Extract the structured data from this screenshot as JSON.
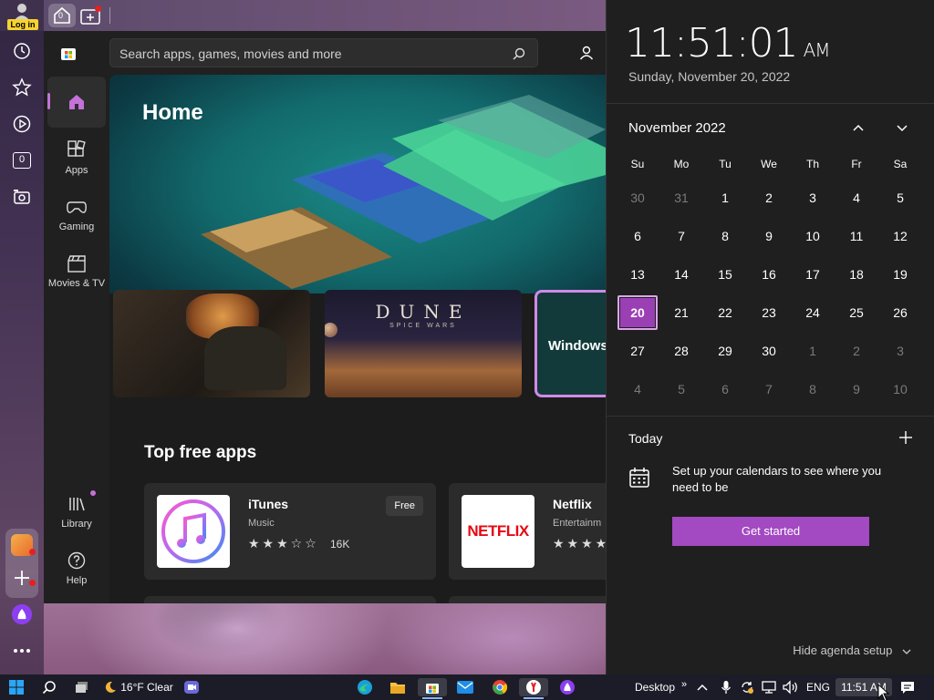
{
  "browser": {
    "login_label": "Log in",
    "tab_counter": "0",
    "side_counter": "0"
  },
  "store": {
    "search_placeholder": "Search apps, games, movies and more",
    "nav": {
      "apps": "Apps",
      "gaming": "Gaming",
      "movies": "Movies & TV",
      "library": "Library",
      "help": "Help"
    },
    "hero_title": "Home",
    "promo_cards": [
      {
        "title": ""
      },
      {
        "title": "DUNE",
        "subtitle": "SPICE WARS"
      },
      {
        "title": "Windows"
      }
    ],
    "section_title": "Top free apps",
    "apps": [
      {
        "name": "iTunes",
        "category": "Music",
        "rating_count": "16K",
        "price": "Free",
        "stars_filled": 3
      },
      {
        "name": "Netflix",
        "category": "Entertainm",
        "icon_text": "NETFLIX"
      }
    ]
  },
  "calendar": {
    "time": "11:51:01",
    "ampm": "AM",
    "date": "Sunday, November 20, 2022",
    "month_label": "November 2022",
    "weekdays": [
      "Su",
      "Mo",
      "Tu",
      "We",
      "Th",
      "Fr",
      "Sa"
    ],
    "weeks": [
      [
        "30",
        "31",
        "1",
        "2",
        "3",
        "4",
        "5"
      ],
      [
        "6",
        "7",
        "8",
        "9",
        "10",
        "11",
        "12"
      ],
      [
        "13",
        "14",
        "15",
        "16",
        "17",
        "18",
        "19"
      ],
      [
        "20",
        "21",
        "22",
        "23",
        "24",
        "25",
        "26"
      ],
      [
        "27",
        "28",
        "29",
        "30",
        "1",
        "2",
        "3"
      ],
      [
        "4",
        "5",
        "6",
        "7",
        "8",
        "9",
        "10"
      ]
    ],
    "today_label": "Today",
    "agenda_text": "Set up your calendars to see where you need to be",
    "get_started": "Get started",
    "hide_agenda": "Hide agenda setup"
  },
  "taskbar": {
    "weather": "16°F Clear",
    "desktop_label": "Desktop",
    "language": "ENG",
    "time": "11:51 AM"
  },
  "colors": {
    "accent": "#a349c2",
    "store_bg": "#202020",
    "flyout_bg": "#1f1f1f"
  }
}
